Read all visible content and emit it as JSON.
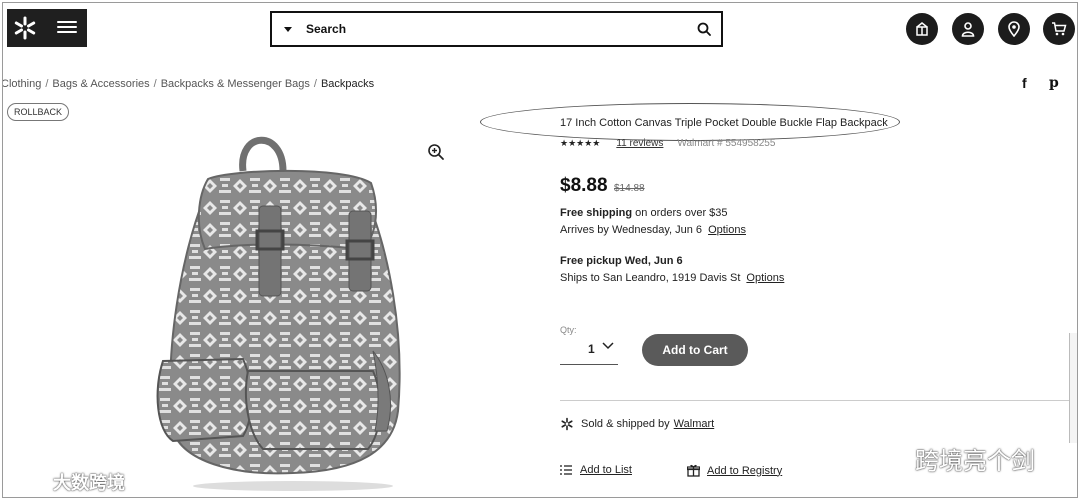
{
  "header": {
    "search_placeholder": "Search",
    "icons": [
      "gift-registry-icon",
      "account-icon",
      "location-icon",
      "cart-icon"
    ]
  },
  "breadcrumb": {
    "items": [
      "Clothing",
      "Bags & Accessories",
      "Backpacks & Messenger Bags"
    ],
    "current": "Backpacks",
    "separator": "/"
  },
  "share": {
    "facebook": "f",
    "pinterest": "p"
  },
  "badge": {
    "label": "ROLLBACK"
  },
  "product": {
    "title": "17 Inch Cotton Canvas Triple Pocket Double Buckle Flap Backpack",
    "stars": "★★★★★",
    "rating": 4.5,
    "reviews": "11 reviews",
    "walmart_number": "Walmart # 554958255",
    "price": "$8.88",
    "was_price": "$14.88"
  },
  "shipping": {
    "free_shipping_bold": "Free shipping",
    "free_shipping_rest": " on orders over $35",
    "arrives": "Arrives by Wednesday, Jun 6",
    "arrives_link": "Options",
    "pickup_bold": "Free pickup Wed, Jun 6",
    "ships_to": "Ships to San Leandro, 1919 Davis St",
    "ships_link": "Options"
  },
  "purchase": {
    "qty_label": "Qty:",
    "qty_value": "1",
    "add_to_cart": "Add to Cart"
  },
  "seller": {
    "prefix": "Sold & shipped by",
    "name": "Walmart"
  },
  "actions": {
    "add_to_list": "Add to List",
    "add_to_registry": "Add to Registry"
  },
  "watermarks": {
    "left": "大数跨境",
    "right": "跨境亮个剑"
  }
}
